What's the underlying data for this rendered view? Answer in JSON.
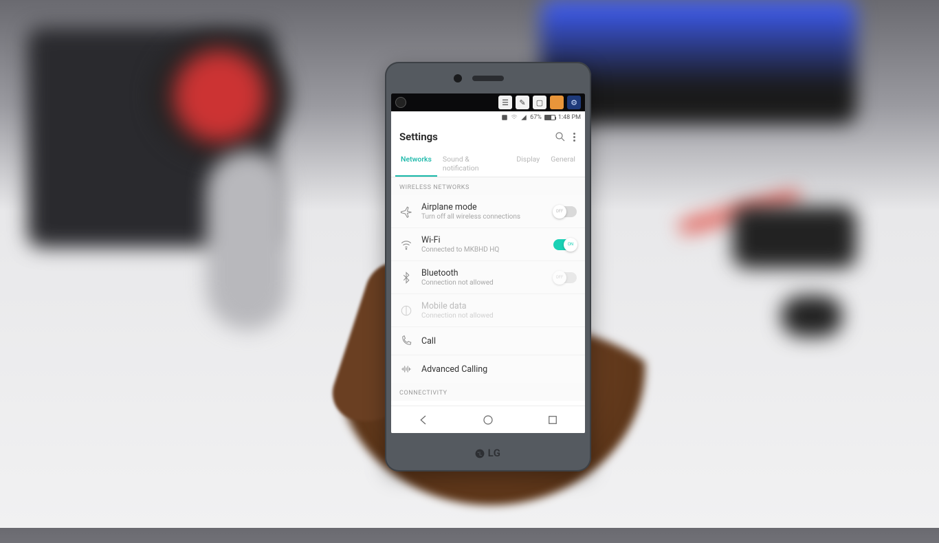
{
  "statusbar": {
    "battery_pct": "67%",
    "time": "1:48 PM"
  },
  "header": {
    "title": "Settings"
  },
  "tabs": [
    {
      "label": "Networks",
      "active": true
    },
    {
      "label": "Sound & notification",
      "active": false
    },
    {
      "label": "Display",
      "active": false
    },
    {
      "label": "General",
      "active": false
    }
  ],
  "sections": {
    "wireless_header": "WIRELESS NETWORKS",
    "connectivity_header": "CONNECTIVITY"
  },
  "rows": {
    "airplane": {
      "label": "Airplane mode",
      "sub": "Turn off all wireless connections",
      "on": false
    },
    "wifi": {
      "label": "Wi-Fi",
      "sub": "Connected to MKBHD HQ",
      "on": true
    },
    "bt": {
      "label": "Bluetooth",
      "sub": "Connection not allowed",
      "on": false
    },
    "mobile": {
      "label": "Mobile data",
      "sub": "Connection not allowed"
    },
    "call": {
      "label": "Call"
    },
    "advcall": {
      "label": "Advanced Calling"
    }
  },
  "phone_brand": "LG"
}
